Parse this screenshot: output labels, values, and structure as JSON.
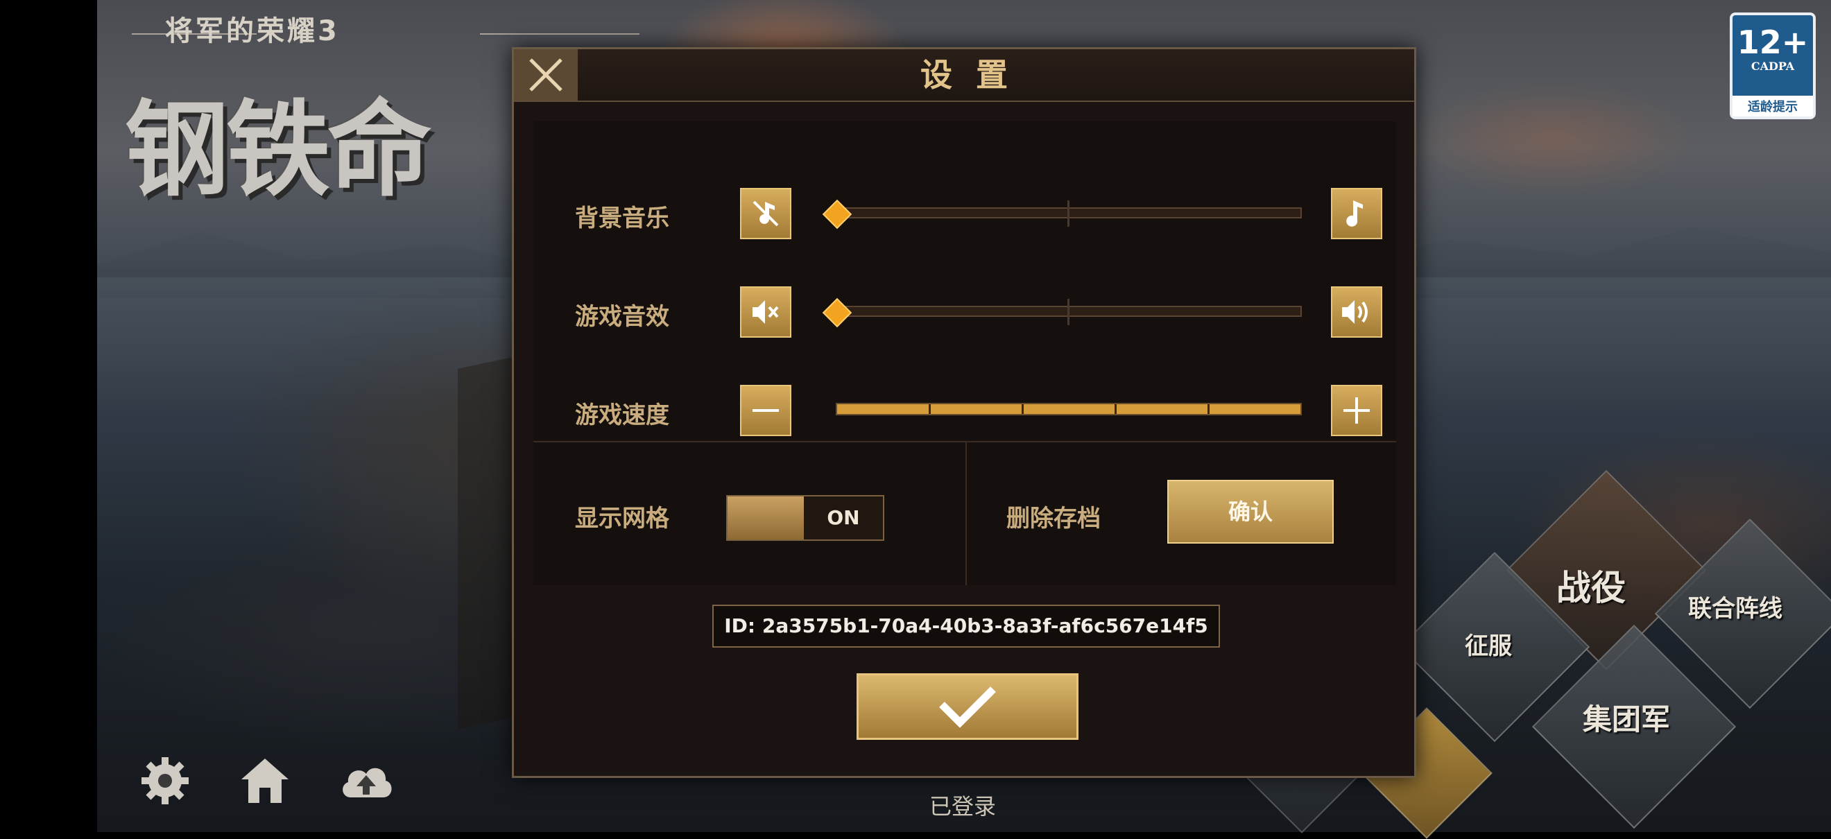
{
  "background": {
    "game_subtitle": "将军的荣耀3",
    "game_logo": "钢铁命"
  },
  "age_rating": {
    "age": "12+",
    "org": "CADPA",
    "tip": "适龄提示"
  },
  "dialog": {
    "title": "设置",
    "rows": {
      "bgm_label": "背景音乐",
      "sfx_label": "游戏音效",
      "speed_label": "游戏速度",
      "bgm_level": 0.0,
      "sfx_level": 0.0,
      "speed_level": 1.0
    },
    "grid": {
      "label": "显示网格",
      "state": "ON"
    },
    "delete_save": {
      "label": "删除存档",
      "button": "确认"
    },
    "player_id": "ID: 2a3575b1-70a4-40b3-8a3f-af6c567e14f5"
  },
  "menu": {
    "campaign": "战役",
    "conquest": "征服",
    "alliance": "联合阵线",
    "army_group": "集团军"
  },
  "status": {
    "logged_in": "已登录"
  },
  "colors": {
    "accent_gold": "#d7ad5d",
    "dialog_bg": "#1a1311",
    "label_text": "#c9ad7f"
  }
}
